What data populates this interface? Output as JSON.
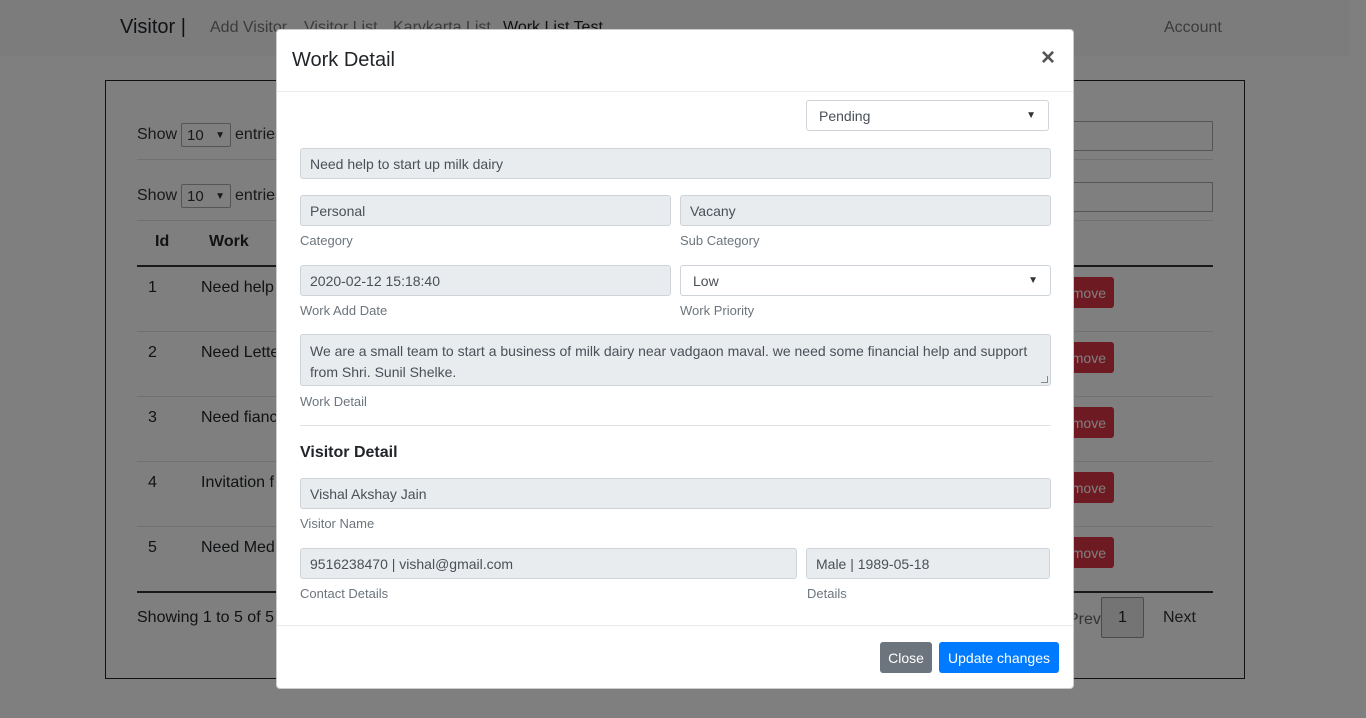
{
  "navbar": {
    "brand": "Visitor |",
    "links": [
      "Add Visitor",
      "Visitor List",
      "Karykarta List",
      "Work List Test"
    ],
    "account": "Account"
  },
  "table": {
    "show_label": "Show",
    "entries_label": "entries",
    "page_size": "10",
    "columns": [
      "Id",
      "Work"
    ],
    "rows": [
      {
        "id": "1",
        "work": "Need help",
        "action": "Remove"
      },
      {
        "id": "2",
        "work": "Need Lette",
        "action": "Remove"
      },
      {
        "id": "3",
        "work": "Need fianc",
        "action": "Remove"
      },
      {
        "id": "4",
        "work": "Invitation f",
        "action": "Remove"
      },
      {
        "id": "5",
        "work": "Need Med",
        "action": "Remove"
      }
    ],
    "info": "Showing 1 to 5 of 5",
    "previous": "Previous",
    "current_page": "1",
    "next": "Next"
  },
  "modal": {
    "title": "Work Detail",
    "close_symbol": "×",
    "status": "Pending",
    "work_title": "Need help to start up milk dairy",
    "category": {
      "value": "Personal",
      "label": "Category"
    },
    "sub_category": {
      "value": "Vacany",
      "label": "Sub Category"
    },
    "add_date": {
      "value": "2020-02-12 15:18:40",
      "label": "Work Add Date"
    },
    "priority": {
      "value": "Low",
      "label": "Work Priority"
    },
    "work_detail": {
      "value": "We are a small team to start a business of milk dairy near vadgaon maval. we need some financial help and support from Shri. Sunil Shelke.",
      "label": "Work Detail"
    },
    "visitor_section_title": "Visitor Detail",
    "visitor_name": {
      "value": "Vishal Akshay Jain",
      "label": "Visitor Name"
    },
    "contact": {
      "value": "9516238470 | vishal@gmail.com",
      "label": "Contact Details"
    },
    "details": {
      "value": "Male | 1989-05-18",
      "label": "Details"
    },
    "close_button": "Close",
    "update_button": "Update changes"
  },
  "colors": {
    "primary": "#007bff",
    "secondary": "#6c757d",
    "danger": "#dc3545"
  }
}
